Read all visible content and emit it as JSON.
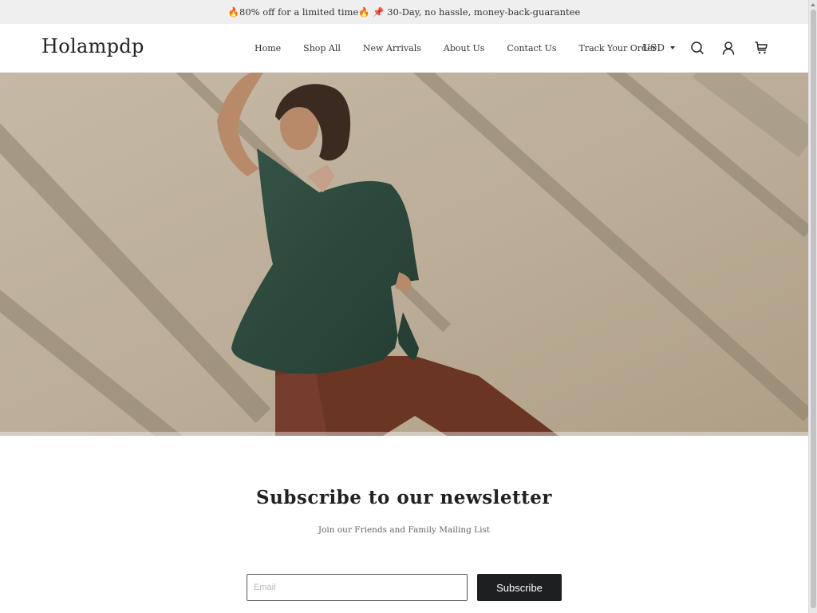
{
  "announcement": {
    "text": "🔥80% off for a limited time🔥 📌 30-Day, no hassle, money-back-guarantee"
  },
  "header": {
    "logo": "Holampdp",
    "nav": [
      {
        "label": "Home"
      },
      {
        "label": "Shop All"
      },
      {
        "label": "New Arrivals"
      },
      {
        "label": "About Us"
      },
      {
        "label": "Contact Us"
      },
      {
        "label": "Track Your Order"
      }
    ],
    "currency": "USD",
    "icons": {
      "search": "search-icon",
      "account": "user-icon",
      "cart": "cart-icon"
    }
  },
  "hero": {
    "alt": "Model in green wrap blouse and rust trousers against sunlit wall",
    "colors": {
      "wall": "#bcae98",
      "shadow": "#8f836f",
      "blouse": "#2e4a3e",
      "trousers": "#6b3524",
      "skin": "#b88a6a",
      "hair": "#3a2a20"
    }
  },
  "newsletter": {
    "title": "Subscribe to our newsletter",
    "subtitle": "Join our Friends and Family Mailing List",
    "email_placeholder": "Email",
    "email_value": "",
    "button_label": "Subscribe"
  },
  "colors": {
    "announcement_bg": "#efefef",
    "button_bg": "#1e1f20",
    "text": "#222222"
  }
}
